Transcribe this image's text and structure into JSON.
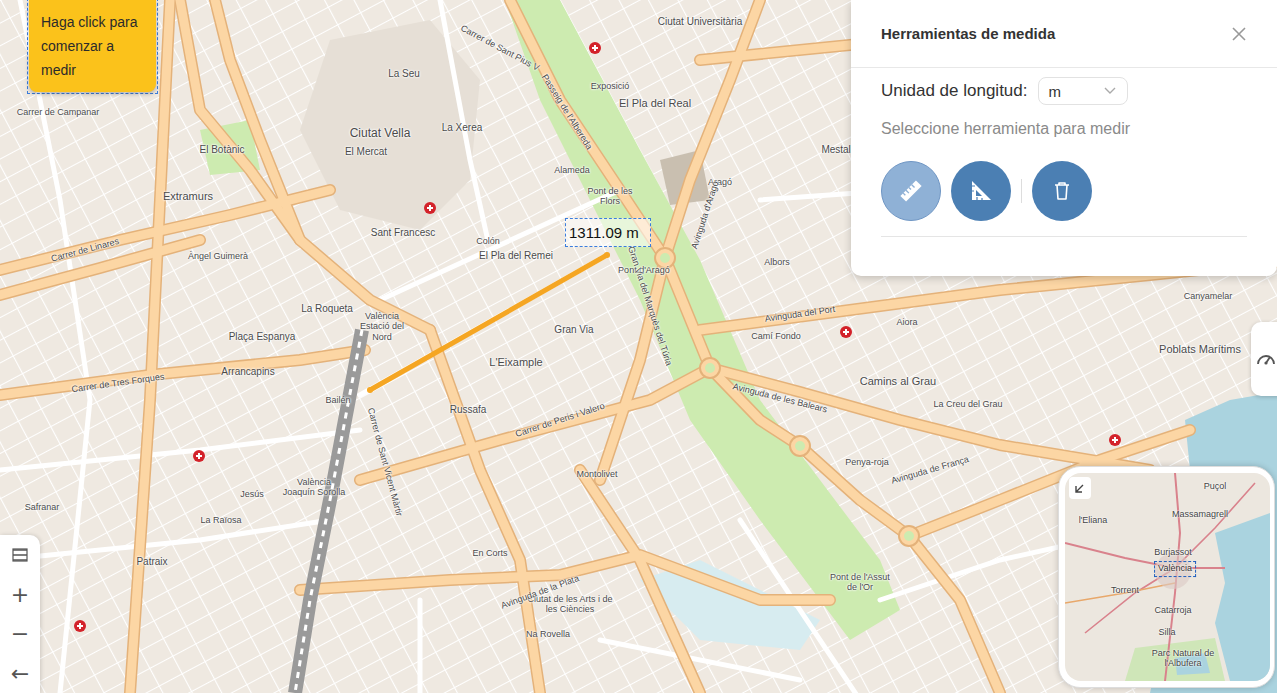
{
  "measure": {
    "tooltip": "Haga click para comenzar a medir",
    "distance": "1311.09 m"
  },
  "panel": {
    "title": "Herramientas de medida",
    "unit_label": "Unidad de longitud:",
    "unit_value": "m",
    "hint": "Seleccione herramienta para medir",
    "tools": [
      {
        "kind": "ruler",
        "selected": true
      },
      {
        "kind": "angle",
        "selected": false
      },
      {
        "kind": "delete",
        "selected": false
      }
    ]
  },
  "map": {
    "labels": [
      {
        "text": "Ciutat Vella"
      },
      {
        "text": "Extramurs"
      },
      {
        "text": "L'Eixample"
      },
      {
        "text": "Ciutat Universitària"
      },
      {
        "text": "El Pla del Real"
      },
      {
        "text": "La Seu"
      },
      {
        "text": "La Xerea"
      },
      {
        "text": "El Mercat"
      },
      {
        "text": "El Botànic"
      },
      {
        "text": "Sant Francesc"
      },
      {
        "text": "El Pla del Remei"
      },
      {
        "text": "Gran Via"
      },
      {
        "text": "Russafa"
      },
      {
        "text": "La Roqueta"
      },
      {
        "text": "Arrancapins"
      },
      {
        "text": "Plaça Espanya"
      },
      {
        "text": "València Estació del Nord"
      },
      {
        "text": "Bailén"
      },
      {
        "text": "València Joaquín Sorolla"
      },
      {
        "text": "Jesús"
      },
      {
        "text": "Patraix"
      },
      {
        "text": "Safranar"
      },
      {
        "text": "La Raïosa"
      },
      {
        "text": "Montolivet"
      },
      {
        "text": "En Corts"
      },
      {
        "text": "Na Rovella"
      },
      {
        "text": "Ciutat de les Arts i de les Ciències"
      },
      {
        "text": "Pont de l'Assut de l'Or"
      },
      {
        "text": "Penya-roja"
      },
      {
        "text": "Camins al Grau"
      },
      {
        "text": "La Creu del Grau"
      },
      {
        "text": "Albors"
      },
      {
        "text": "Aiora"
      },
      {
        "text": "Camí Fondo"
      },
      {
        "text": "Poblats Marítims"
      },
      {
        "text": "Canyamelar"
      },
      {
        "text": "Exposició"
      },
      {
        "text": "Pont de les Flors"
      },
      {
        "text": "Alameda"
      },
      {
        "text": "Aragó"
      },
      {
        "text": "Colón"
      },
      {
        "text": "Pont d'Aragó"
      },
      {
        "text": "Avinguda del Port"
      },
      {
        "text": "Avinguda de les Balears"
      },
      {
        "text": "Avinguda de França"
      },
      {
        "text": "Carrer de Tres Forques"
      },
      {
        "text": "Carrer de Linares"
      },
      {
        "text": "Carrer de Sant Pius V"
      },
      {
        "text": "Passeig de l'Albereda"
      },
      {
        "text": "Avinguda d'Aragó"
      },
      {
        "text": "Gran Via del Marquès del Túria"
      },
      {
        "text": "Carrer de Peris i Valero"
      },
      {
        "text": "Avinguda de la Plata"
      },
      {
        "text": "Carrer de Campanar"
      },
      {
        "text": "Àngel Guimerà"
      },
      {
        "text": "Carrer de Sant Vicent Màrtir"
      },
      {
        "text": "Mestalla"
      }
    ]
  },
  "controls": [
    {
      "kind": "layers"
    },
    {
      "kind": "zoom-in",
      "text": "+"
    },
    {
      "kind": "zoom-out",
      "text": "−"
    },
    {
      "kind": "back",
      "text": "←"
    }
  ],
  "minimap": {
    "labels": [
      {
        "text": "Puçol",
        "selected": false
      },
      {
        "text": "Massamagrell",
        "selected": false
      },
      {
        "text": "l'Eliana",
        "selected": false
      },
      {
        "text": "Burjassot",
        "selected": false
      },
      {
        "text": "València",
        "selected": true
      },
      {
        "text": "Torrent",
        "selected": false
      },
      {
        "text": "Catarroja",
        "selected": false
      },
      {
        "text": "Silla",
        "selected": false
      },
      {
        "text": "Parc Natural de l'Albufera",
        "selected": false
      }
    ]
  }
}
